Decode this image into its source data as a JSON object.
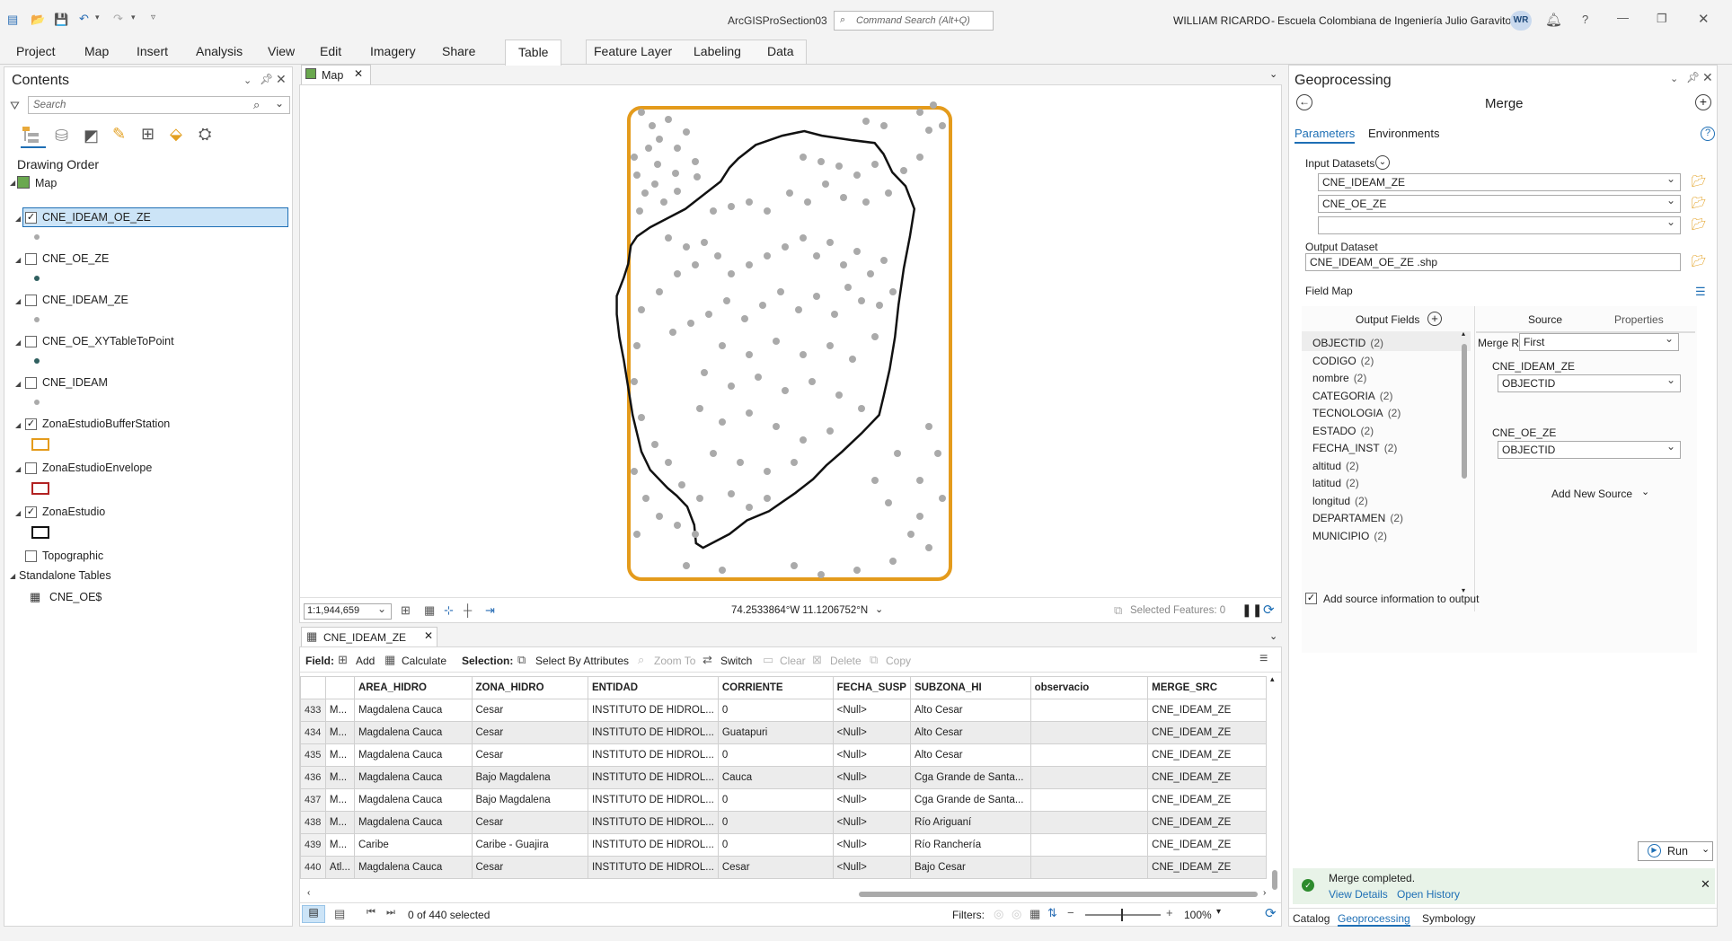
{
  "app": {
    "title": "ArcGISProSection03",
    "command_search_placeholder": "Command Search (Alt+Q)",
    "user": "WILLIAM RICARDO",
    "org": "Escuela Colombiana de Ingeniería Julio Garavito",
    "avatar": "WR"
  },
  "ribbon_tabs": [
    "Project",
    "Map",
    "Insert",
    "Analysis",
    "View",
    "Edit",
    "Imagery",
    "Share",
    "Table",
    "Feature Layer",
    "Labeling",
    "Data"
  ],
  "contents": {
    "title": "Contents",
    "search_placeholder": "Search",
    "drawing_order": "Drawing Order",
    "map_label": "Map",
    "layers": [
      {
        "name": "CNE_IDEAM_OE_ZE",
        "checked": true,
        "selected": true,
        "symbol": "point-gray"
      },
      {
        "name": "CNE_OE_ZE",
        "checked": false,
        "symbol": "point-teal"
      },
      {
        "name": "CNE_IDEAM_ZE",
        "checked": false,
        "symbol": "point-gray"
      },
      {
        "name": "CNE_OE_XYTableToPoint",
        "checked": false,
        "symbol": "point-teal"
      },
      {
        "name": "CNE_IDEAM",
        "checked": false,
        "symbol": "point-gray"
      },
      {
        "name": "ZonaEstudioBufferStation",
        "checked": true,
        "symbol": "poly-orange"
      },
      {
        "name": "ZonaEstudioEnvelope",
        "checked": false,
        "symbol": "poly-red"
      },
      {
        "name": "ZonaEstudio",
        "checked": true,
        "symbol": "poly-black"
      },
      {
        "name": "Topographic",
        "checked": false,
        "symbol": "none"
      }
    ],
    "standalone_tables": "Standalone Tables",
    "table_name": "CNE_OE$"
  },
  "map": {
    "tab": "Map",
    "scale": "1:1,944,659",
    "coordinates": "74.2533864°W 11.1206752°N",
    "selected_features": "Selected Features: 0"
  },
  "attribute_table": {
    "tab": "CNE_IDEAM_ZE",
    "field_label": "Field:",
    "add": "Add",
    "calculate": "Calculate",
    "selection_label": "Selection:",
    "select_by_attributes": "Select By Attributes",
    "zoom_to": "Zoom To",
    "switch": "Switch",
    "clear": "Clear",
    "delete": "Delete",
    "copy": "Copy",
    "columns": [
      "",
      "AREA_HIDRO",
      "ZONA_HIDRO",
      "ENTIDAD",
      "CORRIENTE",
      "FECHA_SUSP",
      "SUBZONA_HI",
      "observacio",
      "MERGE_SRC"
    ],
    "rows": [
      [
        "433",
        "M...",
        "Magdalena Cauca",
        "Cesar",
        "INSTITUTO DE HIDROL...",
        "0",
        "<Null>",
        "Alto Cesar",
        "",
        "CNE_IDEAM_ZE"
      ],
      [
        "434",
        "M...",
        "Magdalena Cauca",
        "Cesar",
        "INSTITUTO DE HIDROL...",
        "Guatapuri",
        "<Null>",
        "Alto Cesar",
        "",
        "CNE_IDEAM_ZE"
      ],
      [
        "435",
        "M...",
        "Magdalena Cauca",
        "Cesar",
        "INSTITUTO DE HIDROL...",
        "0",
        "<Null>",
        "Alto Cesar",
        "",
        "CNE_IDEAM_ZE"
      ],
      [
        "436",
        "M...",
        "Magdalena Cauca",
        "Bajo Magdalena",
        "INSTITUTO DE HIDROL...",
        "Cauca",
        "<Null>",
        "Cga Grande de Santa...",
        "",
        "CNE_IDEAM_ZE"
      ],
      [
        "437",
        "M...",
        "Magdalena Cauca",
        "Bajo Magdalena",
        "INSTITUTO DE HIDROL...",
        "0",
        "<Null>",
        "Cga Grande de Santa...",
        "",
        "CNE_IDEAM_ZE"
      ],
      [
        "438",
        "M...",
        "Magdalena Cauca",
        "Cesar",
        "INSTITUTO DE HIDROL...",
        "0",
        "<Null>",
        "Río Ariguaní",
        "",
        "CNE_IDEAM_ZE"
      ],
      [
        "439",
        "M...",
        "Caribe",
        "Caribe - Guajira",
        "INSTITUTO DE HIDROL...",
        "0",
        "<Null>",
        "Río Ranchería",
        "",
        "CNE_IDEAM_ZE"
      ],
      [
        "440",
        "Atl...",
        "Magdalena Cauca",
        "Cesar",
        "INSTITUTO DE HIDROL...",
        "Cesar",
        "<Null>",
        "Bajo Cesar",
        "",
        "CNE_IDEAM_ZE"
      ]
    ],
    "status": "0 of 440 selected",
    "filters": "Filters:",
    "zoom": "100%"
  },
  "geoprocessing": {
    "title": "Geoprocessing",
    "tool": "Merge",
    "tab_parameters": "Parameters",
    "tab_environments": "Environments",
    "input_datasets_label": "Input Datasets",
    "inputs": [
      "CNE_IDEAM_ZE",
      "CNE_OE_ZE",
      ""
    ],
    "output_dataset_label": "Output Dataset",
    "output_dataset": "CNE_IDEAM_OE_ZE .shp",
    "field_map_label": "Field Map",
    "output_fields_label": "Output Fields",
    "source_tab": "Source",
    "properties_tab": "Properties",
    "fields": [
      {
        "name": "OBJECTID",
        "count": "(2)"
      },
      {
        "name": "CODIGO",
        "count": "(2)"
      },
      {
        "name": "nombre",
        "count": "(2)"
      },
      {
        "name": "CATEGORIA",
        "count": "(2)"
      },
      {
        "name": "TECNOLOGIA",
        "count": "(2)"
      },
      {
        "name": "ESTADO",
        "count": "(2)"
      },
      {
        "name": "FECHA_INST",
        "count": "(2)"
      },
      {
        "name": "altitud",
        "count": "(2)"
      },
      {
        "name": "latitud",
        "count": "(2)"
      },
      {
        "name": "longitud",
        "count": "(2)"
      },
      {
        "name": "DEPARTAMEN",
        "count": "(2)"
      },
      {
        "name": "MUNICIPIO",
        "count": "(2)"
      }
    ],
    "merge_rule_label": "Merge Rule",
    "merge_rule": "First",
    "source1_label": "CNE_IDEAM_ZE",
    "source1_field": "OBJECTID",
    "source2_label": "CNE_OE_ZE",
    "source2_field": "OBJECTID",
    "add_new_source": "Add New Source",
    "add_source_info": "Add source information to output",
    "run": "Run",
    "message": "Merge completed.",
    "view_details": "View Details",
    "open_history": "Open History",
    "bottom_tabs": [
      "Catalog",
      "Geoprocessing",
      "Symbology"
    ]
  },
  "colors": {
    "accent": "#1e6fb5",
    "selection": "#cce4f7",
    "buffer_orange": "#e49b1c",
    "success_bg": "#e8f3e8",
    "point_gray": "#aaaaaa"
  }
}
